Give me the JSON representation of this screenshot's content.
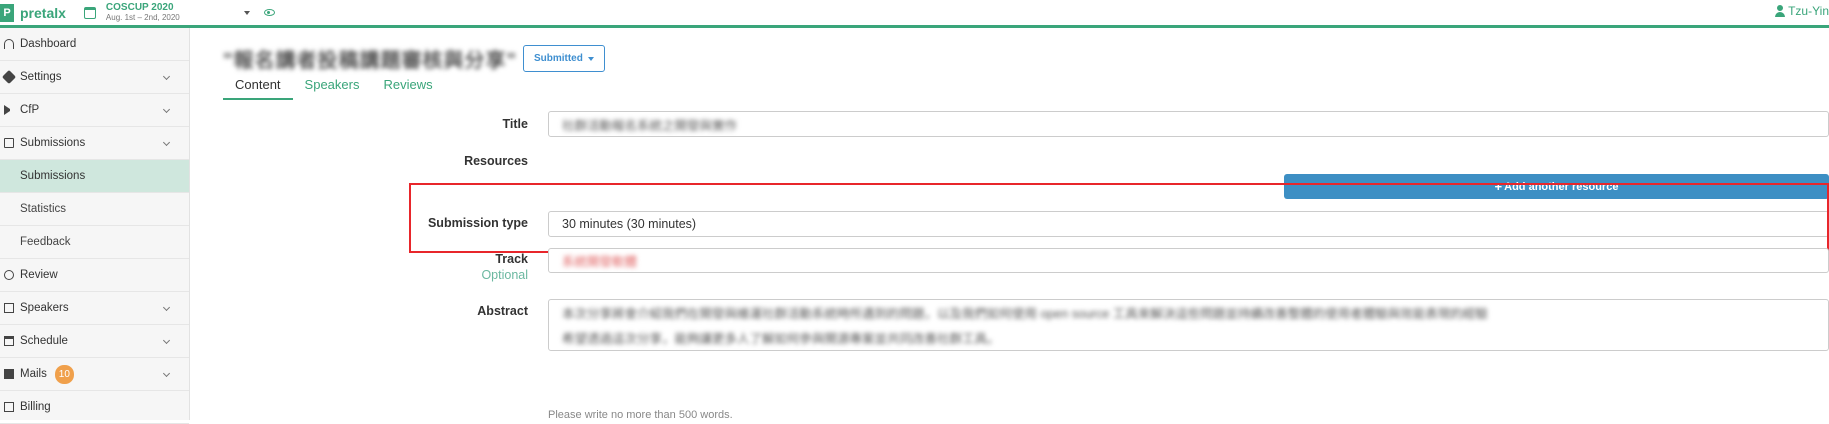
{
  "app": {
    "name": "pretalx",
    "logo_letter": "P"
  },
  "event": {
    "name": "COSCUP 2020",
    "dates": "Aug. 1st – 2nd, 2020"
  },
  "user": {
    "name": "Tzu-Yin"
  },
  "sidebar": {
    "items": [
      {
        "label": "Dashboard",
        "icon": "dashboard-icon",
        "expandable": false
      },
      {
        "label": "Settings",
        "icon": "wrench-icon",
        "expandable": true
      },
      {
        "label": "CfP",
        "icon": "megaphone-icon",
        "expandable": true
      },
      {
        "label": "Submissions",
        "icon": "document-icon",
        "expandable": true
      },
      {
        "label": "Submissions",
        "sub": true,
        "active": true
      },
      {
        "label": "Statistics",
        "sub": true
      },
      {
        "label": "Feedback",
        "sub": true
      },
      {
        "label": "Review",
        "icon": "eye-icon",
        "expandable": false
      },
      {
        "label": "Speakers",
        "icon": "id-card-icon",
        "expandable": true
      },
      {
        "label": "Schedule",
        "icon": "calendar-icon",
        "expandable": true
      },
      {
        "label": "Mails",
        "icon": "envelope-icon",
        "expandable": true,
        "badge": "10"
      },
      {
        "label": "Billing",
        "icon": "billing-icon",
        "expandable": false
      }
    ]
  },
  "submission": {
    "title_blurred": "\"報名講者投稿講題審核與分享\"",
    "state": "Submitted"
  },
  "tabs": [
    "Content",
    "Speakers",
    "Reviews"
  ],
  "form": {
    "title_label": "Title",
    "title_value": "社群活動報名系統之開發與實作",
    "resources_label": "Resources",
    "add_resource": "Add another resource",
    "submission_type_label": "Submission type",
    "submission_type_value": "30 minutes (30 minutes)",
    "track_label": "Track",
    "track_optional": "Optional",
    "track_value": "系統開發軟體",
    "abstract_label": "Abstract",
    "abstract_line1": "本次分享將會介紹我們在開發與維運社群活動系統時所遇到的問題，以及我們如何使用 open source 工具來解決這些問題並持續改善整體的使用者體驗與效能表現的經驗",
    "abstract_line2": "希望透過這次分享，能夠讓更多人了解如何參與開源專案並共同改善社群工具。",
    "char_note": "Please write no more than 500 words."
  },
  "colors": {
    "brand": "#3aa57a",
    "state": "#3f8fd0",
    "highlight": "#e8262b",
    "badge": "#f0a04b"
  }
}
